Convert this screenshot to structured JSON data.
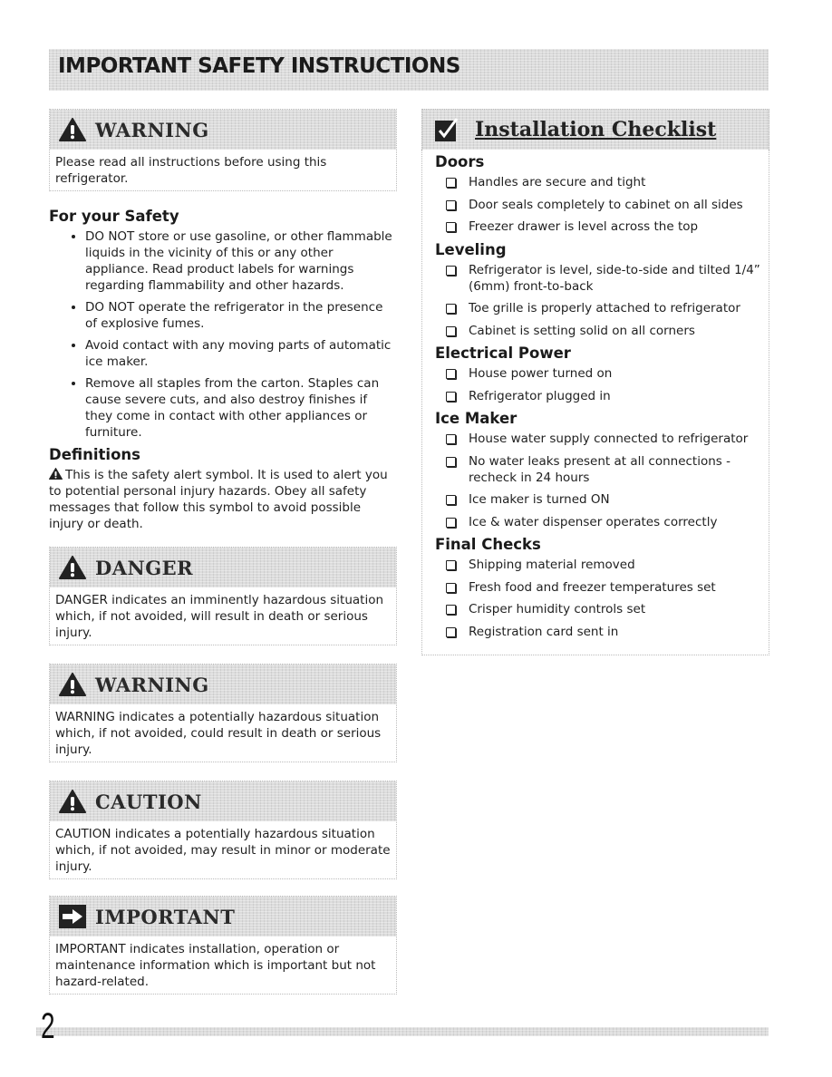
{
  "page": {
    "title": "IMPORTANT SAFETY INSTRUCTIONS",
    "page_number": "2"
  },
  "left": {
    "top_warning": {
      "icon": "warning-triangle-icon",
      "signal_word": "WARNING",
      "text": "Please read all instructions before using this refrigerator."
    },
    "safety": {
      "heading": "For your Safety",
      "bullets": [
        "DO NOT store or use gasoline, or other flammable liquids in the vicinity of this or any other appliance. Read product labels for warnings regarding flammability and other hazards.",
        "DO NOT operate the refrigerator in the presence of explosive fumes.",
        "Avoid contact with any moving parts of automatic ice maker.",
        "Remove all staples from the carton. Staples can cause severe cuts, and also destroy finishes if they come in contact with other appliances or furniture."
      ]
    },
    "definitions": {
      "heading": "Definitions",
      "icon": "safety-alert-icon",
      "text": "This is the safety alert symbol. It is used to alert you to potential personal injury hazards. Obey all safety messages that follow this symbol to avoid possible injury or death."
    },
    "signals": [
      {
        "icon": "warning-triangle-icon",
        "word": "DANGER",
        "text": "DANGER indicates an imminently hazardous situation which, if not avoided, will result in death or serious injury."
      },
      {
        "icon": "warning-triangle-icon",
        "word": "WARNING",
        "text": "WARNING indicates a potentially hazardous situation which, if not avoided, could result in death or serious injury."
      },
      {
        "icon": "warning-triangle-icon",
        "word": "CAUTION",
        "text": "CAUTION indicates a potentially hazardous situation which, if not avoided, may result in minor or moderate injury."
      },
      {
        "icon": "arrow-right-icon",
        "word": "IMPORTANT",
        "text": "IMPORTANT indicates installation, operation or maintenance information which is important but not hazard-related."
      }
    ]
  },
  "checklist": {
    "icon": "checkmark-box-icon",
    "title": "Installation Checklist",
    "groups": [
      {
        "heading": "Doors",
        "items": [
          "Handles are secure and tight",
          "Door seals completely to cabinet on all sides",
          "Freezer drawer is level across the top"
        ]
      },
      {
        "heading": "Leveling",
        "items": [
          "Refrigerator is level, side-to-side and tilted 1/4” (6mm) front-to-back",
          "Toe grille is properly attached to refrigerator",
          "Cabinet is setting solid on all corners"
        ]
      },
      {
        "heading": "Electrical Power",
        "items": [
          "House power turned on",
          "Refrigerator plugged in"
        ]
      },
      {
        "heading": "Ice Maker",
        "items": [
          "House water supply connected to refrigerator",
          "No water leaks present at all connections - recheck in 24 hours",
          "Ice maker is turned ON",
          "Ice & water dispenser operates correctly"
        ]
      },
      {
        "heading": "Final Checks",
        "items": [
          "Shipping material removed",
          "Fresh food and freezer temperatures set",
          "Crisper humidity controls set",
          "Registration card sent in"
        ]
      }
    ]
  },
  "colors": {
    "header_band": "#dcdcdc",
    "text": "#1a1a1a",
    "icon_fill": "#222222"
  }
}
